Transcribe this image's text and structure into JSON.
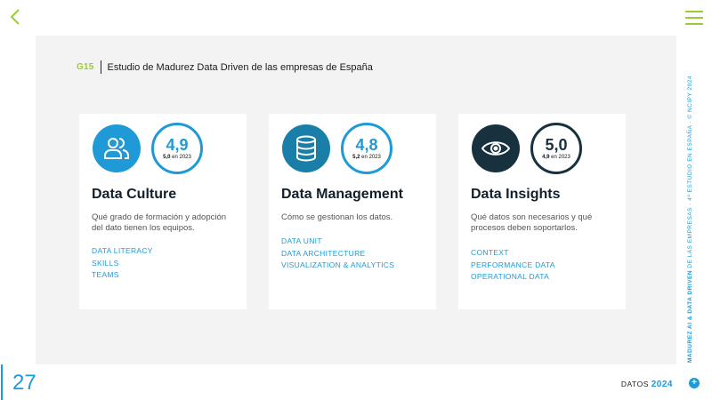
{
  "nav": {
    "back_icon": "chevron-left-icon",
    "menu_icon": "hamburger-menu-icon"
  },
  "heading": {
    "code": "G15",
    "title": "Estudio de Madurez Data Driven de las empresas de España"
  },
  "cards": [
    {
      "icon": "people-icon",
      "icon_color": "#1f9ad6",
      "score": "4,9",
      "prev_value": "5,0",
      "prev_label": "en 2023",
      "name": "Data Culture",
      "desc": "Qué grado de formación y adopción del dato tienen los equipos.",
      "tags": [
        "DATA LITERACY",
        "SKILLS",
        "TEAMS"
      ]
    },
    {
      "icon": "database-icon",
      "icon_color": "#1a7fa8",
      "score": "4,8",
      "prev_value": "5,2",
      "prev_label": "en 2023",
      "name": "Data Management",
      "desc": "Cómo se gestionan los datos.",
      "tags": [
        "DATA UNIT",
        "DATA ARCHITECTURE",
        "VISUALIZATION & ANALYTICS"
      ]
    },
    {
      "icon": "eye-icon",
      "icon_color": "#17313f",
      "score": "5,0",
      "prev_value": "4,9",
      "prev_label": "en 2023",
      "name": "Data Insights",
      "desc": "Qué datos son necesarios y qué procesos deben soportarlos.",
      "tags": [
        "CONTEXT",
        "PERFORMANCE DATA",
        "OPERATIONAL DATA"
      ]
    }
  ],
  "sidebar": {
    "bold": "MADUREZ AI & DATA DRIVEN",
    "rest": " DE LAS EMPRESAS · 4º ESTUDIO EN ESPAÑA · © NCIPY 2024"
  },
  "footer": {
    "page_number": "27",
    "label": "DATOS",
    "year": "2024",
    "plus": "+"
  },
  "colors": {
    "accent": "#1f9ad6",
    "green": "#9acd32",
    "panel": "#f3f3f3"
  }
}
